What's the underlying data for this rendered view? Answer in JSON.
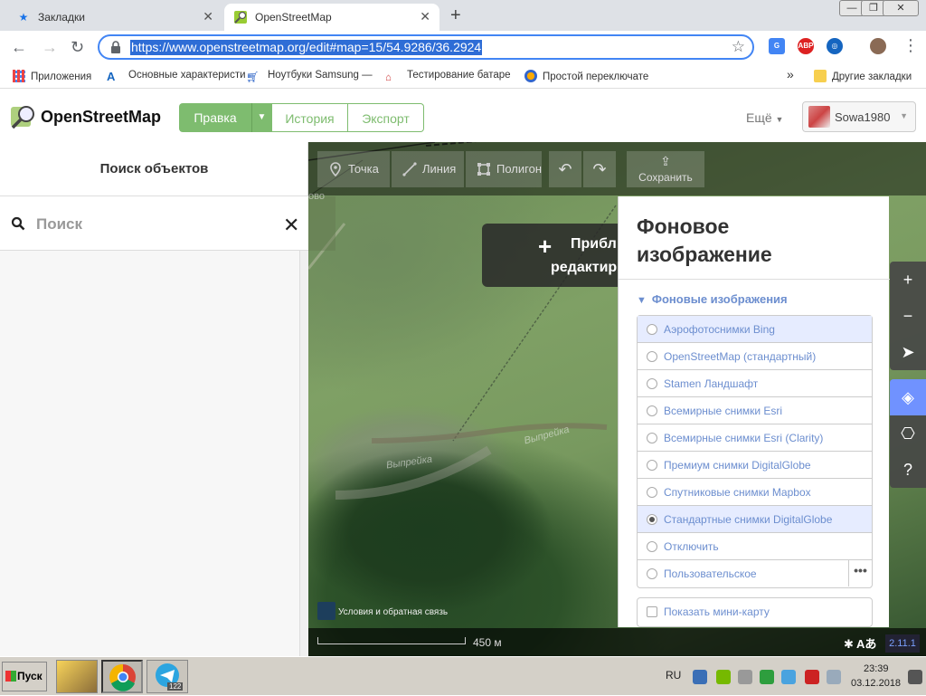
{
  "browser": {
    "tabs": [
      {
        "label": "Закладки"
      },
      {
        "label": "OpenStreetMap"
      }
    ],
    "url": "https://www.openstreetmap.org/edit#map=15/54.9286/36.2924",
    "bookmarks": [
      {
        "label": "Приложения"
      },
      {
        "label": "Основные характеристи"
      },
      {
        "label": "Ноутбуки Samsung —"
      },
      {
        "label": "Тестирование батаре"
      },
      {
        "label": "Простой переключате"
      }
    ],
    "bookmarks_overflow": "»",
    "other_bookmarks": "Другие закладки"
  },
  "osm": {
    "logo": "OpenStreetMap",
    "nav": {
      "edit": "Правка",
      "history": "История",
      "export": "Экспорт"
    },
    "more": "Ещё",
    "username": "Sowa1980"
  },
  "sidebar": {
    "title": "Поиск объектов",
    "search_placeholder": "Поиск"
  },
  "editor": {
    "tools": {
      "point": "Точка",
      "line": "Линия",
      "polygon": "Полигон",
      "save": "Сохранить"
    },
    "notice_line1": "Прибл",
    "notice_line2": "редактир",
    "map_labels": [
      "Выпрейка",
      "Выпрейка",
      "ово"
    ],
    "terms": "Условия и обратная связь",
    "scale": "450 м",
    "version": "2.11.1"
  },
  "background_pane": {
    "title_line1": "Фоновое",
    "title_line2": "изображение",
    "section": "Фоновые изображения",
    "items": [
      {
        "label": "Аэрофотоснимки Bing",
        "selected": false
      },
      {
        "label": "OpenStreetMap (стандартный)",
        "selected": false
      },
      {
        "label": "Stamen Ландшафт",
        "selected": false
      },
      {
        "label": "Всемирные снимки Esri",
        "selected": false
      },
      {
        "label": "Всемирные снимки Esri (Clarity)",
        "selected": false
      },
      {
        "label": "Премиум снимки DigitalGlobe",
        "selected": false
      },
      {
        "label": "Спутниковые снимки Mapbox",
        "selected": false
      },
      {
        "label": "Стандартные снимки DigitalGlobe",
        "selected": true
      },
      {
        "label": "Отключить",
        "selected": false
      },
      {
        "label": "Пользовательское",
        "selected": false
      }
    ],
    "custom_more": "•••",
    "minimap": "Показать мини-карту"
  },
  "taskbar": {
    "start": "Пуск",
    "telegram_badge": "122",
    "lang": "RU",
    "time": "23:39",
    "date": "03.12.2018"
  },
  "colors": {
    "osm_green": "#7ebc6f",
    "link_blue": "#6c8ecf",
    "selected_row": "#e6ecff",
    "layers_active": "#7092ff"
  }
}
